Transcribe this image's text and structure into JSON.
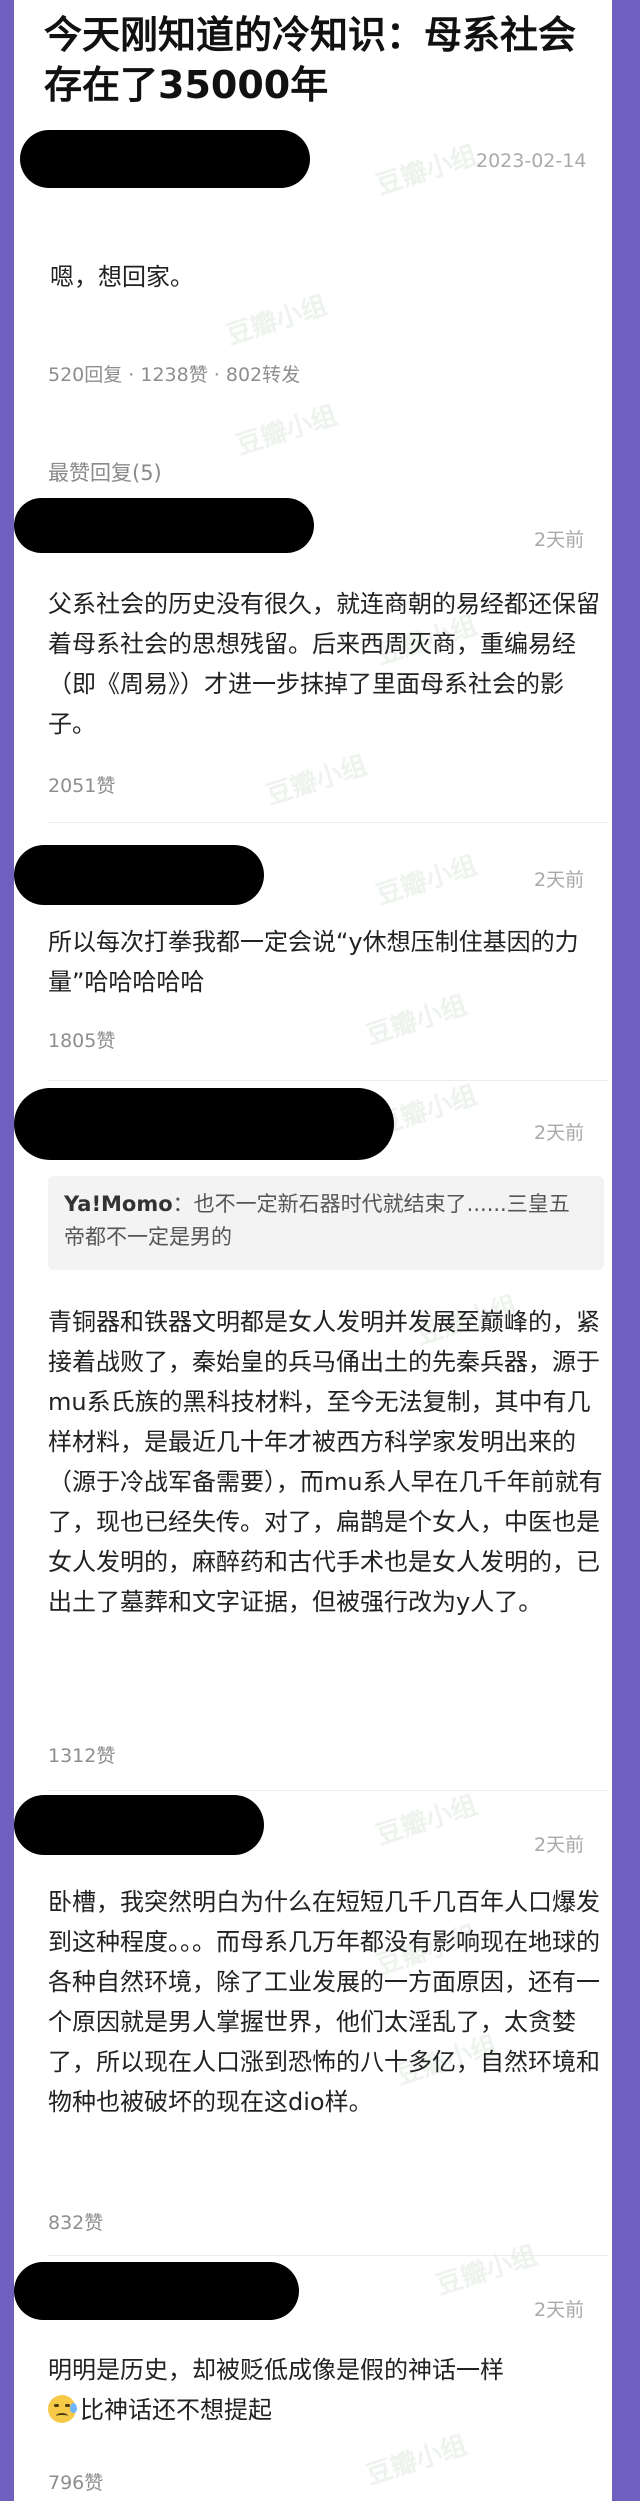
{
  "post": {
    "title": "今天刚知道的冷知识：母系社会存在了35000年",
    "date": "2023-02-14",
    "content": "嗯，想回家。",
    "stats": "520回复 · 1238赞 · 802转发"
  },
  "replies_label": "最赞回复(5)",
  "comments": [
    {
      "time": "2天前",
      "text": "父系社会的历史没有很久，就连商朝的易经都还保留着母系社会的思想残留。后来西周灭商，重编易经（即《周易》）才进一步抹掉了里面母系社会的影子。",
      "likes": "2051赞"
    },
    {
      "time": "2天前",
      "text": "所以每次打拳我都一定会说“y休想压制住基因的力量”哈哈哈哈哈",
      "likes": "1805赞"
    },
    {
      "time": "2天前",
      "quote_author": "Ya!Momo",
      "quote_text": "：也不一定新石器时代就结束了......三皇五帝都不一定是男的",
      "text": "青铜器和铁器文明都是女人发明并发展至巅峰的，紧接着战败了，秦始皇的兵马俑出土的先秦兵器，源于mu系氏族的黑科技材料，至今无法复制，其中有几样材料，是最近几十年才被西方科学家发明出来的（源于冷战军备需要），而mu系人早在几千年前就有了，现也已经失传。对了，扁鹊是个女人，中医也是女人发明的，麻醉药和古代手术也是女人发明的，已出土了墓葬和文字证据，但被强行改为y人了。",
      "likes": "1312赞"
    },
    {
      "time": "2天前",
      "text": "卧槽，我突然明白为什么在短短几千几百年人口爆发到这种程度。。。而母系几万年都没有影响现在地球的各种自然环境，除了工业发展的一方面原因，还有一个原因就是男人掌握世界，他们太淫乱了，太贪婪了，所以现在人口涨到恐怖的八十多亿，自然环境和物种也被破坏的现在这dio样。",
      "likes": "832赞"
    },
    {
      "time": "2天前",
      "text_a": "明明是历史，却被贬低成像是假的神话一样",
      "emoji": "sweat-smile-emoji",
      "text_b": "比神话还不想提起",
      "likes": "796赞"
    }
  ],
  "watermark": "豆瓣小组"
}
